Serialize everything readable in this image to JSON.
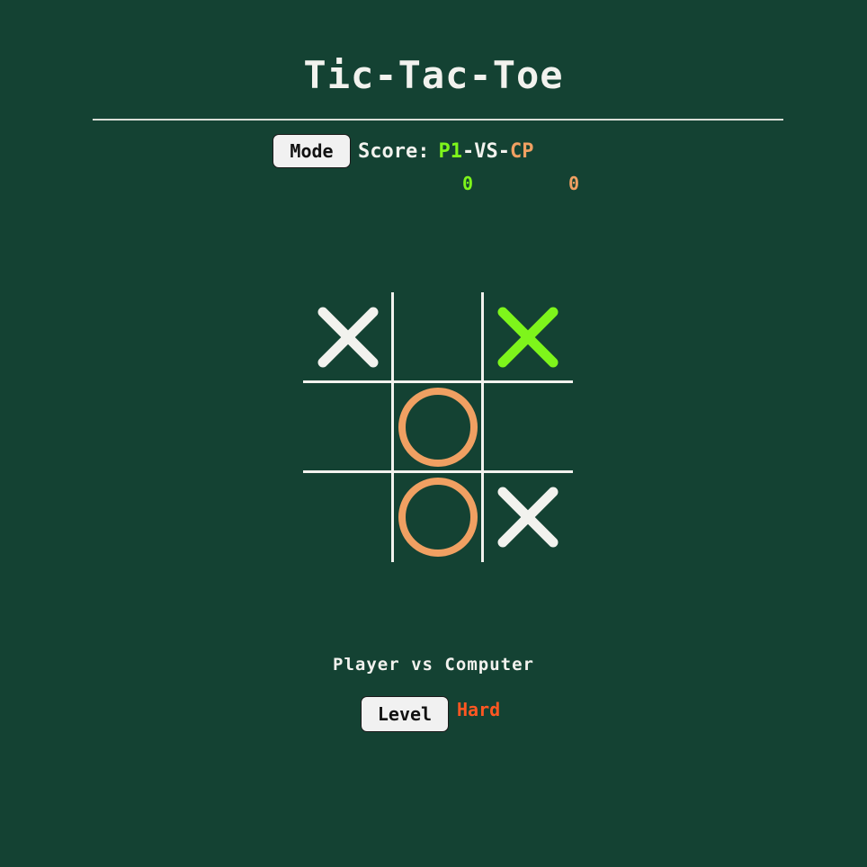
{
  "title": "Tic-Tac-Toe",
  "controls": {
    "mode_label": "Mode",
    "level_label": "Level",
    "level_value": "Hard"
  },
  "score": {
    "label": "Score:",
    "p1_label": "P1",
    "vs_label": "-VS-",
    "cp_label": "CP",
    "p1_score": "0",
    "cp_score": "0"
  },
  "mode_text": "Player vs Computer",
  "board": {
    "cells": [
      {
        "mark": "X",
        "color": "#f2f2ee"
      },
      {
        "mark": "",
        "color": ""
      },
      {
        "mark": "X",
        "color": "#7ef51b"
      },
      {
        "mark": "",
        "color": ""
      },
      {
        "mark": "O",
        "color": "#f0a062"
      },
      {
        "mark": "",
        "color": ""
      },
      {
        "mark": "",
        "color": ""
      },
      {
        "mark": "O",
        "color": "#f0a062"
      },
      {
        "mark": "X",
        "color": "#f2f2ee"
      }
    ]
  },
  "colors": {
    "background": "#144233",
    "foreground": "#f2f2ee",
    "player": "#7ef51b",
    "computer": "#f0a062",
    "level": "#ff5722"
  }
}
